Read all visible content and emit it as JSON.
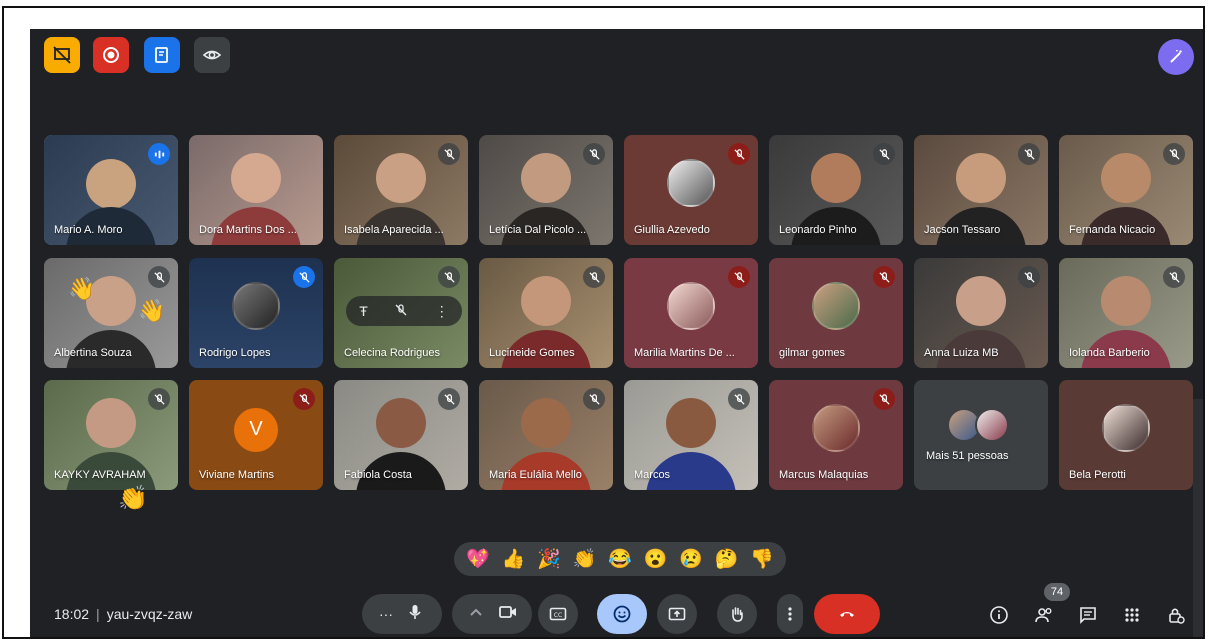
{
  "meeting": {
    "time": "18:02",
    "code": "yau-zvqz-zaw",
    "people_count": "74"
  },
  "top_toolbar": [
    {
      "name": "no-presentation-icon",
      "color": "#f9ab00"
    },
    {
      "name": "record-icon",
      "color": "#d93025"
    },
    {
      "name": "transcript-icon",
      "color": "#1a73e8"
    },
    {
      "name": "eye-icon",
      "color": "#3c4043"
    }
  ],
  "participants": [
    {
      "name": "Mario A. Moro",
      "mic": "speaking"
    },
    {
      "name": "Dora Martins Dos ...",
      "mic": "none"
    },
    {
      "name": "Isabela Aparecida ...",
      "mic": "muted"
    },
    {
      "name": "Letícia Dal Picolo ...",
      "mic": "muted"
    },
    {
      "name": "Giullia Azevedo",
      "mic": "muted-red"
    },
    {
      "name": "Leonardo Pinho",
      "mic": "muted"
    },
    {
      "name": "Jacson Tessaro",
      "mic": "muted"
    },
    {
      "name": "Fernanda Nicacio",
      "mic": "muted"
    },
    {
      "name": "Albertina Souza",
      "mic": "muted"
    },
    {
      "name": "Rodrigo Lopes",
      "mic": "muted-blue"
    },
    {
      "name": "Celecina Rodrigues",
      "mic": "muted"
    },
    {
      "name": "Lucineide Gomes",
      "mic": "muted"
    },
    {
      "name": "Marilia Martins De ...",
      "mic": "muted-red"
    },
    {
      "name": "gilmar gomes",
      "mic": "muted-red"
    },
    {
      "name": "Anna Luiza MB",
      "mic": "muted"
    },
    {
      "name": "Iolanda Barberio",
      "mic": "muted"
    },
    {
      "name": "KAYKY AVRAHAM",
      "mic": "muted"
    },
    {
      "name": "Viviane Martins",
      "mic": "muted-red"
    },
    {
      "name": "Fabiola Costa",
      "mic": "muted"
    },
    {
      "name": "Maria Eulália Mello",
      "mic": "muted"
    },
    {
      "name": "Marcos",
      "mic": "muted"
    },
    {
      "name": "Marcus Malaquias",
      "mic": "muted-red"
    },
    {
      "name": "Mais 51 pessoas",
      "mic": "none"
    },
    {
      "name": "Bela Perotti",
      "mic": "none"
    }
  ],
  "viviane_initial": "V",
  "reactions": [
    "💖",
    "👍",
    "🎉",
    "👏",
    "😂",
    "😮",
    "😢",
    "🤔",
    "👎"
  ],
  "hand_emoji": "👏",
  "wave_emoji": "👋",
  "pin_glyph": "Ŧ",
  "more_glyph": "⋮"
}
